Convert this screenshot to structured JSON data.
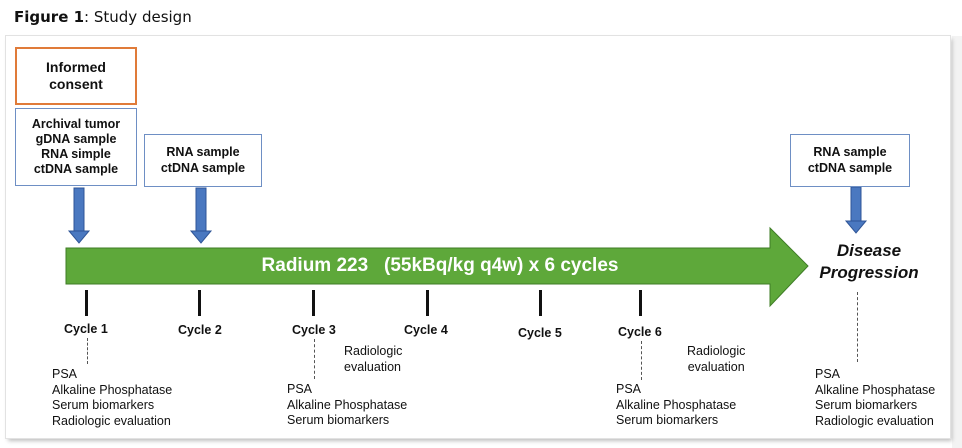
{
  "caption": {
    "bold": "Figure 1",
    "rest": ": Study design"
  },
  "diagram": {
    "consent": "Informed\nconsent",
    "baseline_samples": "Archival tumor\ngDNA sample\nRNA simple\nctDNA sample",
    "cycle2_samples": "RNA sample\nctDNA sample",
    "progression_samples": "RNA sample\nctDNA sample",
    "treatment": "Radium 223   (55kBq/kg q4w) x 6 cycles",
    "disease_progression": "Disease\nProgression",
    "cycles": [
      "Cycle 1",
      "Cycle 2",
      "Cycle 3",
      "Cycle 4",
      "Cycle 5",
      "Cycle 6"
    ],
    "cycle1_assessments": "PSA\nAlkaline Phosphatase\nSerum biomarkers\nRadiologic evaluation",
    "cycle3_assessments": "PSA\nAlkaline Phosphatase\nSerum biomarkers",
    "cycle6_assessments": "PSA\nAlkaline Phosphatase\nSerum biomarkers",
    "progression_assessments": "PSA\nAlkaline Phosphatase\nSerum biomarkers\nRadiologic evaluation",
    "radiologic_cycle3": "Radiologic\nevaluation",
    "radiologic_cycle6": "Radiologic\nevaluation"
  },
  "colors": {
    "arrow_green": "#5ea83a",
    "arrow_blue": "#4a78c0",
    "consent_border": "#e07b39",
    "box_border": "#6e8fc4"
  }
}
